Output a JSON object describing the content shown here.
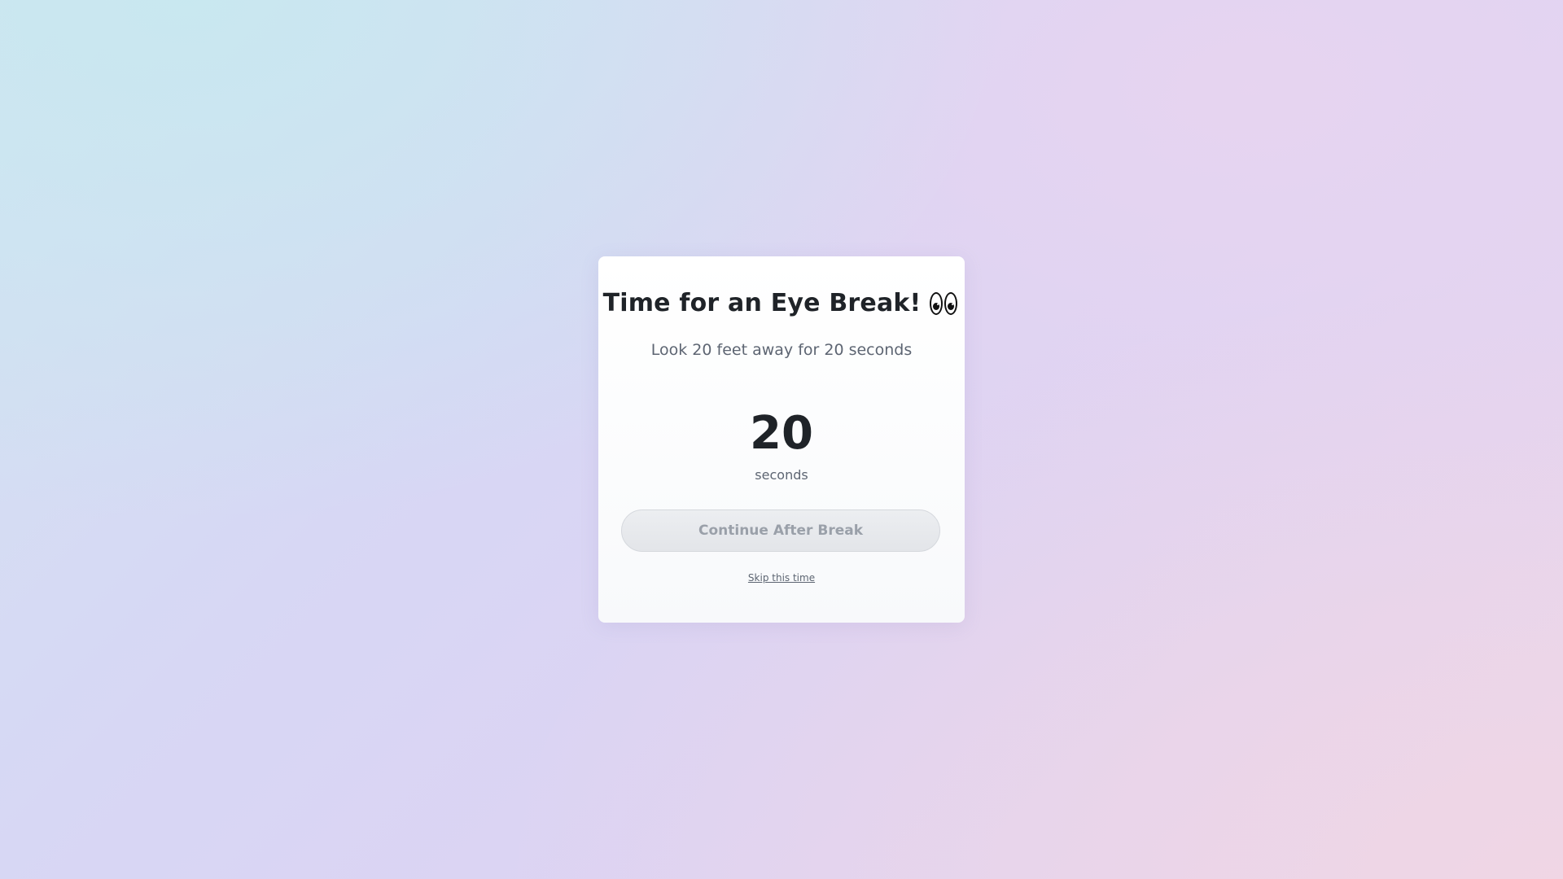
{
  "dialog": {
    "title": "Time for an Eye Break!",
    "title_icon": "eyes-icon",
    "subtitle": "Look 20 feet away for 20 seconds",
    "countdown_value": "20",
    "countdown_unit": "seconds",
    "continue_label": "Continue After Break",
    "continue_disabled": true,
    "skip_label": "Skip this time"
  }
}
